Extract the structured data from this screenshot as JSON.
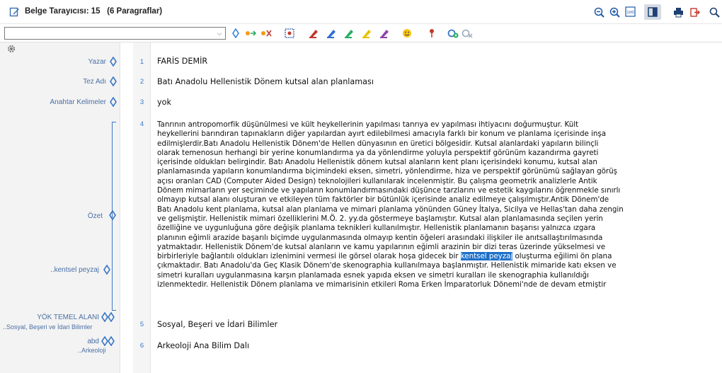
{
  "window": {
    "title": "Belge Tarayıcısı: 15",
    "paragraph_count": "(6 Paragraflar)"
  },
  "toolbar": {
    "combo_value": "",
    "icons": [
      "diamond-icon",
      "code-arrow-icon",
      "code-remove-icon",
      "select-code-icon",
      "marker-red-icon",
      "marker-blue-icon",
      "marker-green-icon",
      "marker-yellow-icon",
      "marker-purple-icon",
      "emoji-icon",
      "pin-icon",
      "link-add-icon",
      "link-remove-icon"
    ]
  },
  "header_icons": [
    "zoom-out-icon",
    "zoom-in-icon",
    "zoom-100-icon",
    "panel-toggle-icon",
    "print-icon",
    "export-icon",
    "search-icon"
  ],
  "fields": {
    "author": "Yazar",
    "title": "Tez Adı",
    "keywords": "Anahtar Kelimeler",
    "abstract": "Özet",
    "code": "..kentsel peyzaj",
    "yok_field": "YÖK TEMEL ALANI",
    "yok_sub": "..Sosyal, Beşeri ve İdari Bilimler",
    "abd": "abd",
    "abd_sub": "..Arkeoloji"
  },
  "paragraphs": {
    "p1": {
      "num": "1",
      "text": "FARİS DEMİR"
    },
    "p2": {
      "num": "2",
      "text": "Batı Anadolu Hellenistik Dönem kutsal alan planlaması"
    },
    "p3": {
      "num": "3",
      "text": "yok"
    },
    "p4": {
      "num": "4",
      "lines": [
        "Tanrının antropomorfik düşünülmesi ve kült heykellerinin yapılması tanrıya ev yapılması ihtiyacını doğurmuştur. Kült",
        "heykellerini barındıran tapınakların diğer yapılardan ayırt edilebilmesi amacıyla farklı bir konum ve planlama içerisinde inşa",
        "edilmişlerdir.Batı Anadolu Hellenistik Dönem'de Hellen dünyasının en üretici bölgesidir. Kutsal alanlardaki yapıların bilinçli",
        "olarak temenosun herhangi bir yerine konumlandırma ya da yönlendirme yoluyla perspektif görünüm kazandırma gayreti",
        "içerisinde oldukları belirgindir. Batı Anadolu Hellenistik dönem kutsal alanların kent planı içerisindeki konumu, kutsal alan",
        "planlamasında yapıların konumlandırma biçimindeki eksen, simetri, yönlendirme, hiza ve perspektif görünümü sağlayan görüş",
        "açısı oranları CAD (Computer Aided Design) teknolojileri kullanılarak incelenmiştir. Bu çalışma geometrik analizlerle Antik",
        "Dönem mimarların yer seçiminde ve yapıların konumlandırmasındaki düşünce tarzlarını ve estetik kaygılarını öğrenmekle sınırlı",
        "olmayıp kutsal alanı oluşturan ve etkileyen tüm faktörler bir bütünlük içerisinde analiz edilmeye çalışılmıştır.Antik Dönem'de",
        "Batı Anadolu kent planlama, kutsal alan planlama ve mimari planlama yönünden Güney İtalya, Sicilya ve Hellas'tan daha zengin",
        "ve gelişmiştir. Hellenistik mimari özelliklerini M.Ö. 2. yy.da göstermeye başlamıştır. Kutsal alan planlamasında seçilen yerin",
        "özelliğine ve uygunluğuna göre değişik planlama teknikleri kullanılmıştır. Hellenistik planlamanın başarısı yalnızca ızgara",
        "planının eğimli arazide başarılı biçimde uygulanmasında olmayıp kentin öğeleri arasındaki ilişkiler ile anıtsallaştırılmasında",
        "yatmaktadır. Hellenistik Dönem'de kutsal alanların ve kamu yapılarının eğimli arazinin bir dizi teras üzerinde yükselmesi ve"
      ],
      "line_before_hl": "birbirleriyle bağlantılı oldukları izlenimini vermesi ile görsel olarak hoşa gidecek bir ",
      "highlight": "kentsel peyzaj",
      "line_after_hl": " oluşturma eğilimi ön plana",
      "tail_lines": [
        "çıkmaktadır. Batı Anadolu'da Geç Klasik Dönem'de skenographia kullanılmaya başlanmıştır. Hellenistik mimaride katı eksen ve",
        "simetri kuralları uygulanmasına karşın planlamada esnek yapıda eksen ve simetri kuralları ile skenographia kullanıldığı",
        "izlenmektedir. Hellenistik Dönem planlama ve mimarisinin etkileri Roma Erken İmparatorluk Dönemi'nde de devam etmiştir"
      ]
    },
    "p5": {
      "num": "5",
      "text": "Sosyal, Beşeri ve İdari Bilimler"
    },
    "p6": {
      "num": "6",
      "text": "Arkeoloji Ana Bilim Dalı"
    }
  },
  "colors": {
    "accent": "#3a78c4",
    "highlight": "#1e70c9",
    "label": "#4a6fa5"
  }
}
